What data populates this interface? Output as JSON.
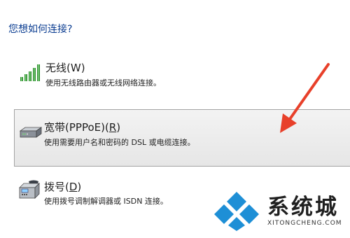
{
  "prompt": "您想如何连接?",
  "options": [
    {
      "icon": "wireless-signal-icon",
      "title_prefix": "无线(",
      "title_key": "W",
      "title_suffix": ")",
      "description": "使用无线路由器或无线网络连接。",
      "selected": false
    },
    {
      "icon": "broadband-modem-icon",
      "title_prefix": "宽带(PPPoE)(",
      "title_key": "R",
      "title_suffix": ")",
      "description": "使用需要用户名和密码的 DSL 或电缆连接。",
      "selected": true
    },
    {
      "icon": "dialup-phone-icon",
      "title_prefix": "拨号(",
      "title_key": "D",
      "title_suffix": ")",
      "description": "使用拨号调制解调器或 ISDN 连接。",
      "selected": false
    }
  ],
  "annotation": {
    "arrow_color": "#e8402a"
  },
  "watermark": {
    "brand_name": "系统城",
    "brand_url": "XITONGCHENG.COM",
    "logo_color": "#1e8fd6"
  }
}
